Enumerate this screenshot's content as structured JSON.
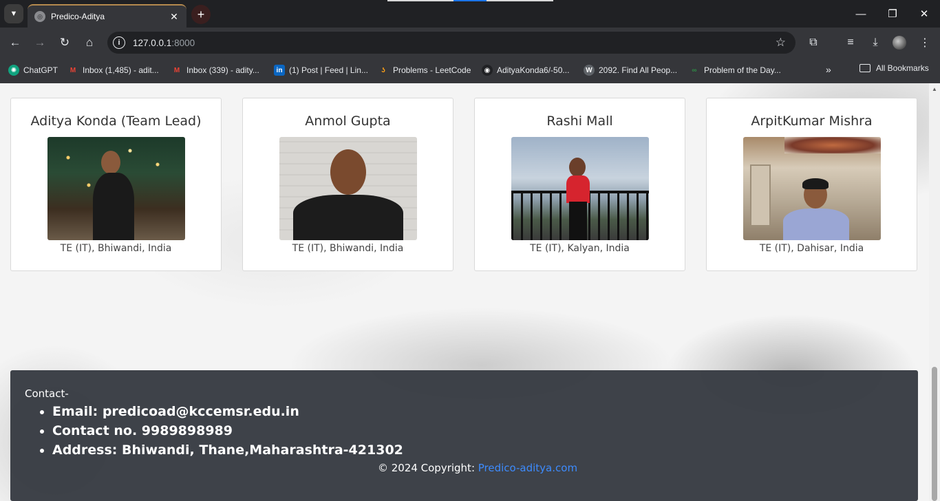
{
  "browser": {
    "tab_title": "Predico-Aditya",
    "url_host": "127.0.0.1",
    "url_port": ":8000",
    "bookmarks": [
      {
        "label": "ChatGPT",
        "icon": "chatgpt-icon",
        "color": "#10a37f"
      },
      {
        "label": "Inbox (1,485) - adit...",
        "icon": "gmail-icon",
        "color": "#ea4335"
      },
      {
        "label": "Inbox (339) - adity...",
        "icon": "gmail-icon",
        "color": "#ea4335"
      },
      {
        "label": "(1) Post | Feed | Lin...",
        "icon": "linkedin-icon",
        "color": "#0a66c2"
      },
      {
        "label": "Problems - LeetCode",
        "icon": "leetcode-icon",
        "color": "#ffa116"
      },
      {
        "label": "AdityaKonda6/-50...",
        "icon": "github-icon",
        "color": "#ffffff"
      },
      {
        "label": "2092. Find All Peop...",
        "icon": "w-icon",
        "color": "#5f6368"
      },
      {
        "label": "Problem of the Day...",
        "icon": "gfg-icon",
        "color": "#2f8d46"
      }
    ],
    "all_bookmarks": "All Bookmarks"
  },
  "team": [
    {
      "name": "Aditya Konda (Team Lead)",
      "location": "TE (IT), Bhiwandi, India"
    },
    {
      "name": "Anmol Gupta",
      "location": "TE (IT), Bhiwandi, India"
    },
    {
      "name": "Rashi Mall",
      "location": "TE (IT), Kalyan, India"
    },
    {
      "name": "ArpitKumar Mishra",
      "location": "TE (IT), Dahisar, India"
    }
  ],
  "footer": {
    "contact_label": "Contact-",
    "items": [
      "Email: predicoad@kccemsr.edu.in",
      "Contact no. 9989898989",
      "Address: Bhiwandi, Thane,Maharashtra-421302"
    ],
    "copyright_text": "© 2024 Copyright: ",
    "copyright_link": "Predico-aditya.com"
  }
}
